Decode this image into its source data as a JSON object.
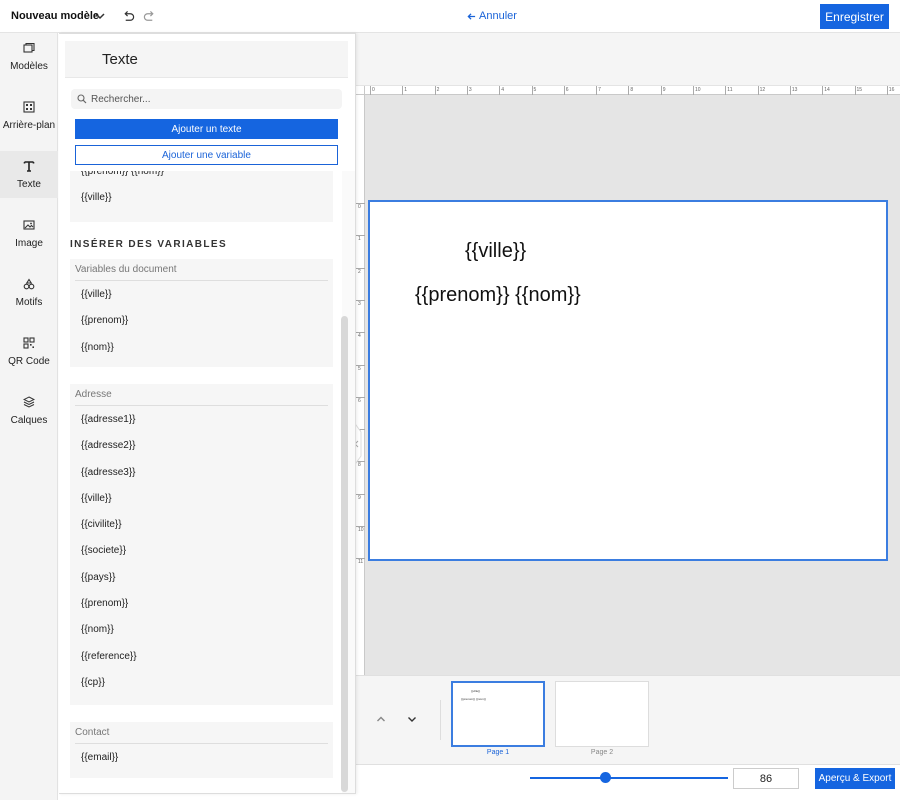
{
  "header": {
    "template_name": "Nouveau modèle",
    "cancel_label": "Annuler",
    "save_label": "Enregistrer"
  },
  "sidebar": {
    "items": [
      {
        "label": "Modèles",
        "icon": "templates-icon"
      },
      {
        "label": "Arrière-plan",
        "icon": "background-icon"
      },
      {
        "label": "Texte",
        "icon": "text-icon",
        "active": true
      },
      {
        "label": "Image",
        "icon": "image-icon"
      },
      {
        "label": "Motifs",
        "icon": "shapes-icon"
      },
      {
        "label": "QR Code",
        "icon": "qr-code-icon"
      },
      {
        "label": "Calques",
        "icon": "layers-icon"
      }
    ]
  },
  "panel": {
    "title": "Texte",
    "search_placeholder": "Rechercher...",
    "add_text_label": "Ajouter un texte",
    "add_variable_label": "Ajouter une variable",
    "existing_texts": [
      "{{prenom}} {{nom}}",
      "{{ville}}"
    ],
    "insert_title": "INSÉRER DES VARIABLES",
    "groups": [
      {
        "title": "Variables du document",
        "items": [
          "{{ville}}",
          "{{prenom}}",
          "{{nom}}"
        ]
      },
      {
        "title": "Adresse",
        "items": [
          "{{adresse1}}",
          "{{adresse2}}",
          "{{adresse3}}",
          "{{ville}}",
          "{{civilite}}",
          "{{societe}}",
          "{{pays}}",
          "{{prenom}}",
          "{{nom}}",
          "{{reference}}",
          "{{cp}}"
        ]
      },
      {
        "title": "Contact",
        "items": [
          "{{email}}"
        ]
      }
    ]
  },
  "ruler": {
    "top_ticks": [
      "0",
      "1",
      "2",
      "3",
      "4",
      "5",
      "6",
      "7",
      "8",
      "9",
      "10",
      "11",
      "12",
      "13",
      "14",
      "15",
      "16"
    ],
    "left_ticks": [
      "0",
      "1",
      "2",
      "3",
      "4",
      "5",
      "6",
      "7",
      "8",
      "9",
      "10",
      "11"
    ]
  },
  "canvas": {
    "texts": [
      "{{ville}}",
      "{{prenom}} {{nom}}"
    ]
  },
  "pages": [
    {
      "label": "Page 1",
      "active": true
    },
    {
      "label": "Page 2",
      "active": false
    }
  ],
  "zoom": {
    "value": "86",
    "level": 0.38
  },
  "export_label": "Aperçu & Export",
  "colors": {
    "accent": "#1565e0",
    "selection_border": "#3b7de0"
  }
}
